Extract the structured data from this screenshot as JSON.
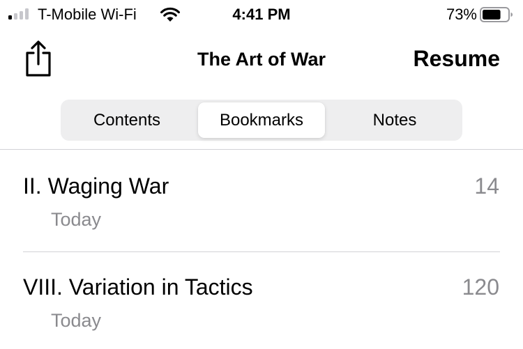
{
  "status_bar": {
    "carrier": "T-Mobile Wi-Fi",
    "time": "4:41 PM",
    "battery_percent": "73%",
    "signal_bars_active": 1,
    "signal_bars_total": 4,
    "battery_level": 0.73
  },
  "nav": {
    "title": "The Art of War",
    "resume_label": "Resume",
    "share_icon": "share-icon"
  },
  "segmented": {
    "items": [
      {
        "label": "Contents",
        "selected": false
      },
      {
        "label": "Bookmarks",
        "selected": true
      },
      {
        "label": "Notes",
        "selected": false
      }
    ]
  },
  "bookmarks": [
    {
      "title": "II. Waging War",
      "page": "14",
      "date": "Today"
    },
    {
      "title": "VIII. Variation in Tactics",
      "page": "120",
      "date": "Today"
    }
  ],
  "colors": {
    "text_primary": "#000000",
    "text_secondary": "#8a8a8e",
    "segment_bg": "#eeeeef",
    "divider": "#d1d1d6"
  }
}
